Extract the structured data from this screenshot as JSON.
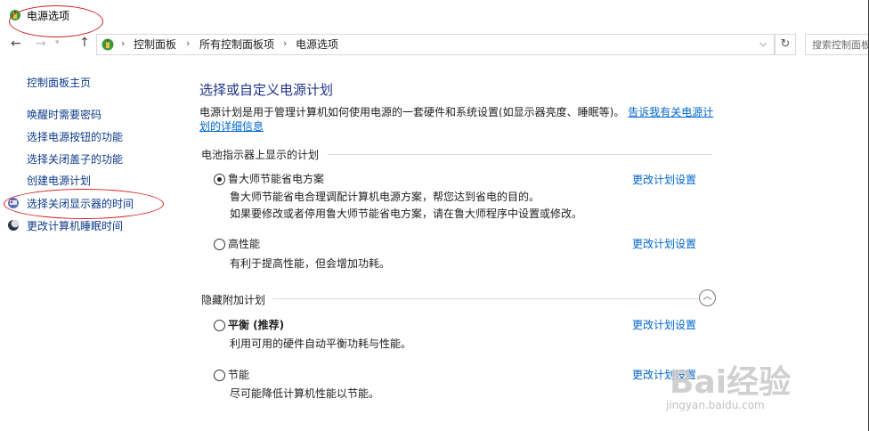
{
  "window": {
    "title": "电源选项"
  },
  "address": {
    "crumbs": [
      "控制面板",
      "所有控制面板项",
      "电源选项"
    ],
    "search_placeholder": "搜索控制面板"
  },
  "sidebar": {
    "home": "控制面板主页",
    "items": [
      {
        "label": "唤醒时需要密码"
      },
      {
        "label": "选择电源按钮的功能"
      },
      {
        "label": "选择关闭盖子的功能"
      },
      {
        "label": "创建电源计划"
      },
      {
        "label": "选择关闭显示器的时间",
        "icon": "monitor-power-icon"
      },
      {
        "label": "更改计算机睡眠时间",
        "icon": "moon-icon"
      }
    ]
  },
  "main": {
    "title": "选择或自定义电源计划",
    "description": "电源计划是用于管理计算机如何使用电源的一套硬件和系统设置(如显示器亮度、睡眠等)。",
    "description_link": "告诉我有关电源计划的详细信息",
    "section_battery": "电池指示器上显示的计划",
    "section_hidden": "隐藏附加计划",
    "plans": [
      {
        "name": "鲁大师节能省电方案",
        "selected": true,
        "desc": [
          "鲁大师节能省电合理调配计算机电源方案，帮您达到省电的目的。",
          "如果要修改或者停用鲁大师节能省电方案，请在鲁大师程序中设置或修改。"
        ],
        "link": "更改计划设置"
      },
      {
        "name": "高性能",
        "selected": false,
        "desc": [
          "有利于提高性能，但会增加功耗。"
        ],
        "link": "更改计划设置"
      },
      {
        "name": "平衡 (推荐)",
        "selected": false,
        "desc": [
          "利用可用的硬件自动平衡功耗与性能。"
        ],
        "link": "更改计划设置"
      },
      {
        "name": "节能",
        "selected": false,
        "desc": [
          "尽可能降低计算机性能以节能。"
        ],
        "link": "更改计划设置"
      }
    ]
  },
  "watermark": {
    "main": "Bai经验",
    "sub": "jingyan.baidu.com"
  },
  "colors": {
    "link": "#0066cc",
    "heading": "#1e3287",
    "annotation": "#d02020"
  }
}
